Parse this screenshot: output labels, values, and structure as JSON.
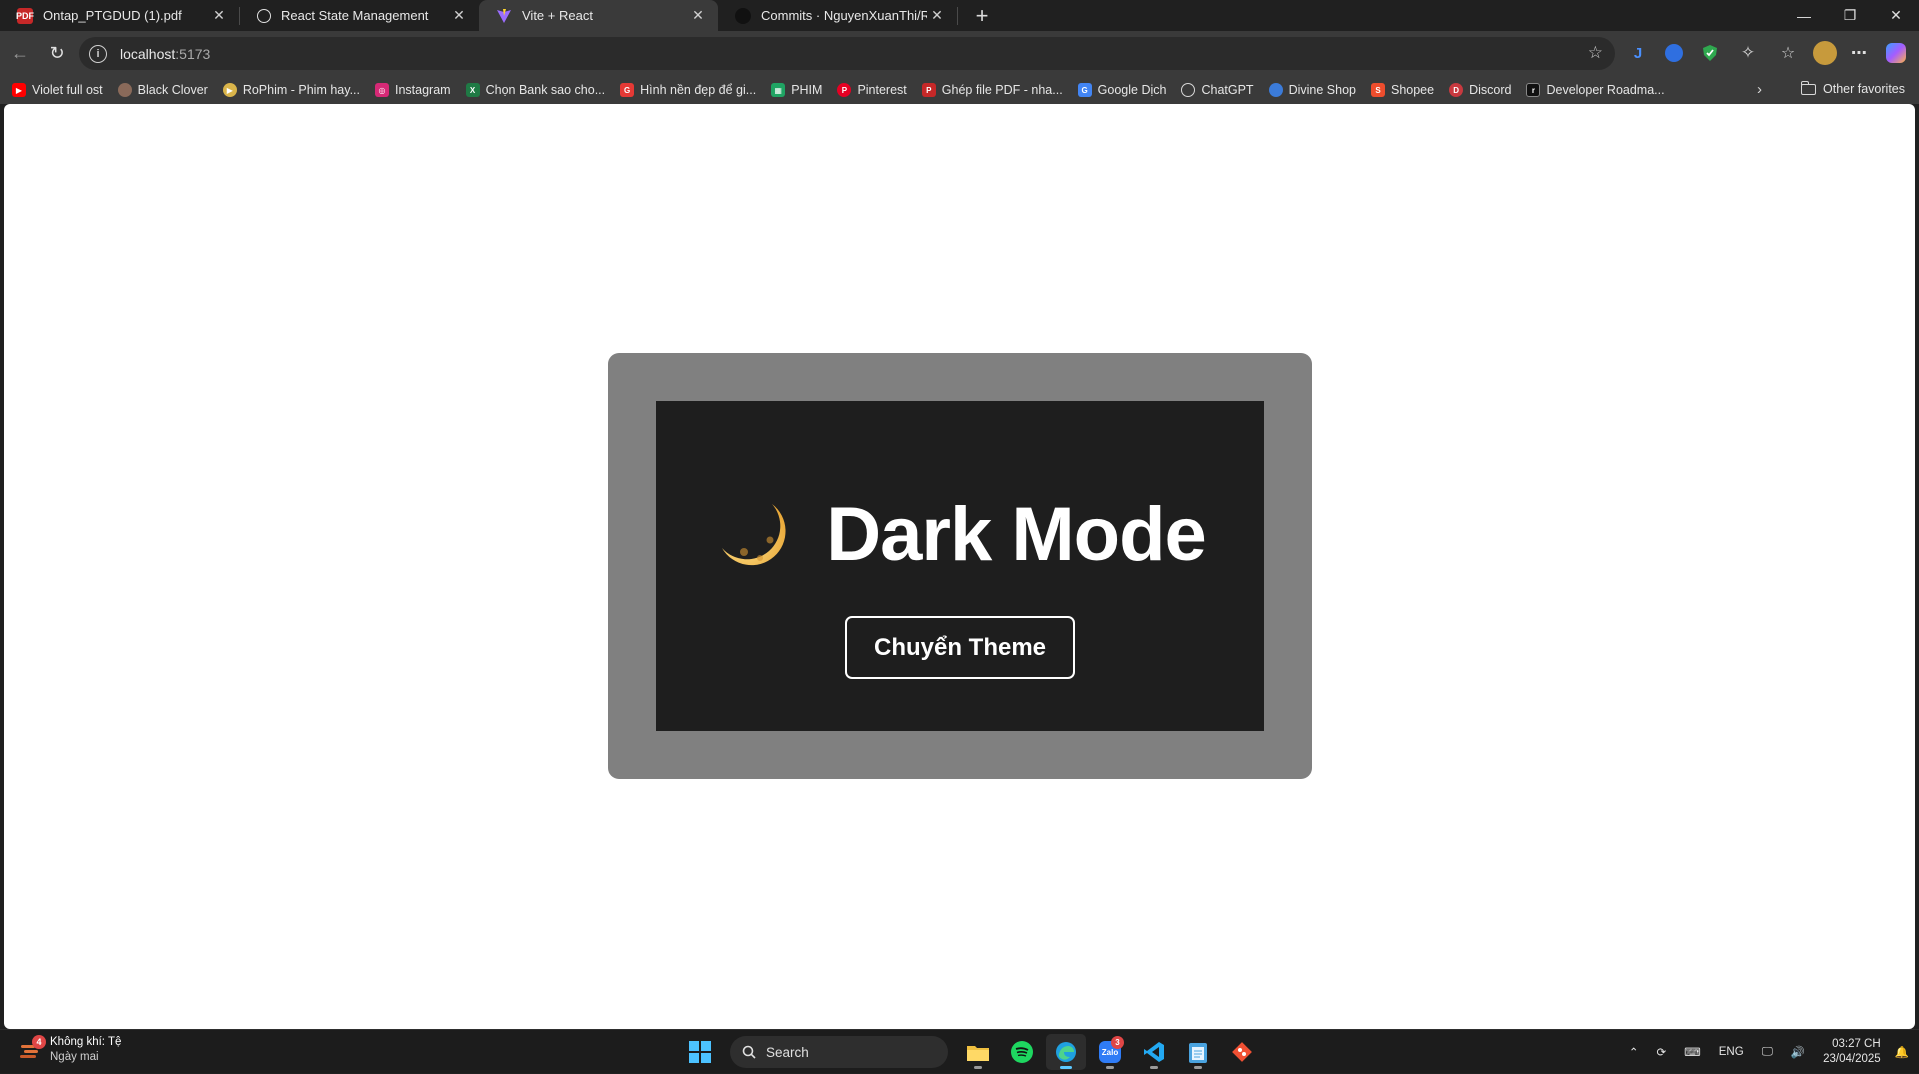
{
  "browser": {
    "tabs": [
      {
        "title": "Ontap_PTGDUD (1).pdf",
        "icon": "pdf-icon",
        "active": false
      },
      {
        "title": "React State Management",
        "icon": "chatgpt-icon",
        "active": false
      },
      {
        "title": "Vite + React",
        "icon": "vite-icon",
        "active": true
      },
      {
        "title": "Commits · NguyenXuanThi/REACT",
        "icon": "github-icon",
        "active": false
      }
    ],
    "address": {
      "host": "localhost",
      "port": ":5173"
    },
    "bookmarks": [
      {
        "label": "Violet full ost",
        "icon": "youtube-icon",
        "color": "#ff0000"
      },
      {
        "label": "Black Clover",
        "icon": "avatar-icon",
        "color": "#8a6a5a"
      },
      {
        "label": "RoPhim - Phim hay...",
        "icon": "rophim-icon",
        "color": "#d9b44a"
      },
      {
        "label": "Instagram",
        "icon": "instagram-icon",
        "color": "#d62976"
      },
      {
        "label": "Chọn Bank sao cho...",
        "icon": "excel-icon",
        "color": "#1f7a45"
      },
      {
        "label": "Hình nền đẹp để gi...",
        "icon": "g-icon",
        "color": "#e53935"
      },
      {
        "label": "PHIM",
        "icon": "sheets-icon",
        "color": "#1fa463"
      },
      {
        "label": "Pinterest",
        "icon": "pinterest-icon",
        "color": "#e60023"
      },
      {
        "label": "Ghép file PDF - nha...",
        "icon": "pdf-icon",
        "color": "#c62828"
      },
      {
        "label": "Google Dịch",
        "icon": "translate-icon",
        "color": "#4285f4"
      },
      {
        "label": "ChatGPT",
        "icon": "chatgpt-icon",
        "color": "#6e6e6e"
      },
      {
        "label": "Divine Shop",
        "icon": "divine-icon",
        "color": "#3b7bd9"
      },
      {
        "label": "Shopee",
        "icon": "shopee-icon",
        "color": "#ee4d2d"
      },
      {
        "label": "Discord",
        "icon": "discord-icon",
        "color": "#c8393f"
      },
      {
        "label": "Developer Roadma...",
        "icon": "roadmap-icon",
        "color": "#111111"
      }
    ],
    "other_favorites": "Other favorites"
  },
  "page": {
    "card_outer_color": "#808080",
    "card_inner_color": "#1e1e1e",
    "heading": "Dark Mode",
    "heading_icon": "crescent-moon-icon",
    "toggle_button": "Chuyển Theme"
  },
  "taskbar": {
    "weather": {
      "line1": "Không khí: Tệ",
      "line2": "Ngày mai",
      "badge": "4"
    },
    "search_label": "Search",
    "zalo_badge": "3",
    "language": "ENG",
    "time": "03:27 CH",
    "date": "23/04/2025"
  }
}
